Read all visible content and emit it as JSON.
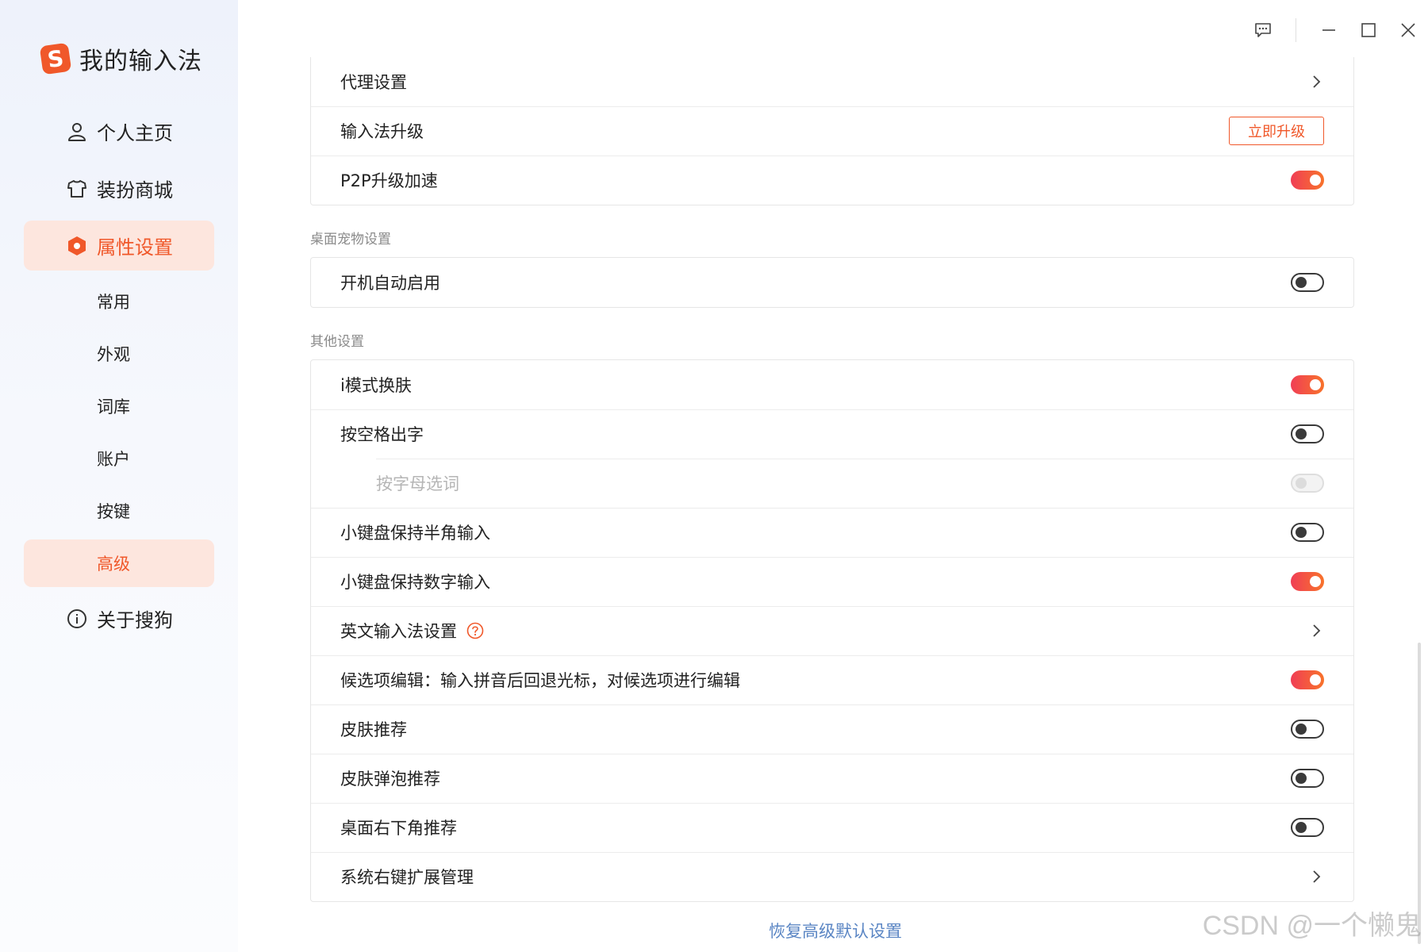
{
  "brand": {
    "name": "我的输入法",
    "logo_icon": "sogou-s-logo-icon"
  },
  "nav": {
    "profile": "个人主页",
    "skins": "装扮商城",
    "settings": "属性设置",
    "settings_sub": [
      "常用",
      "外观",
      "词库",
      "账户",
      "按键",
      "高级"
    ],
    "about": "关于搜狗"
  },
  "titlebar": {
    "icons": [
      "feedback-icon",
      "minimize-icon",
      "maximize-icon",
      "close-icon"
    ]
  },
  "top_card": {
    "proxy": "代理设置",
    "upgrade": "输入法升级",
    "upgrade_btn": "立即升级",
    "p2p": "P2P升级加速"
  },
  "pet_section": {
    "title": "桌面宠物设置",
    "autostart": "开机自动启用"
  },
  "other_section": {
    "title": "其他设置",
    "items": [
      "i模式换肤",
      "按空格出字",
      "按字母选词",
      "小键盘保持半角输入",
      "小键盘保持数字输入",
      "英文输入法设置",
      "候选项编辑：输入拼音后回退光标，对候选项进行编辑",
      "皮肤推荐",
      "皮肤弹泡推荐",
      "桌面右下角推荐",
      "系统右键扩展管理"
    ]
  },
  "restore": "恢复高级默认设置",
  "watermark": "CSDN @一个懒鬼",
  "colors": {
    "accent": "#f0582a",
    "active_bg": "#fde6de",
    "link": "#5b86c4",
    "toggle_on": "#f5513e"
  }
}
